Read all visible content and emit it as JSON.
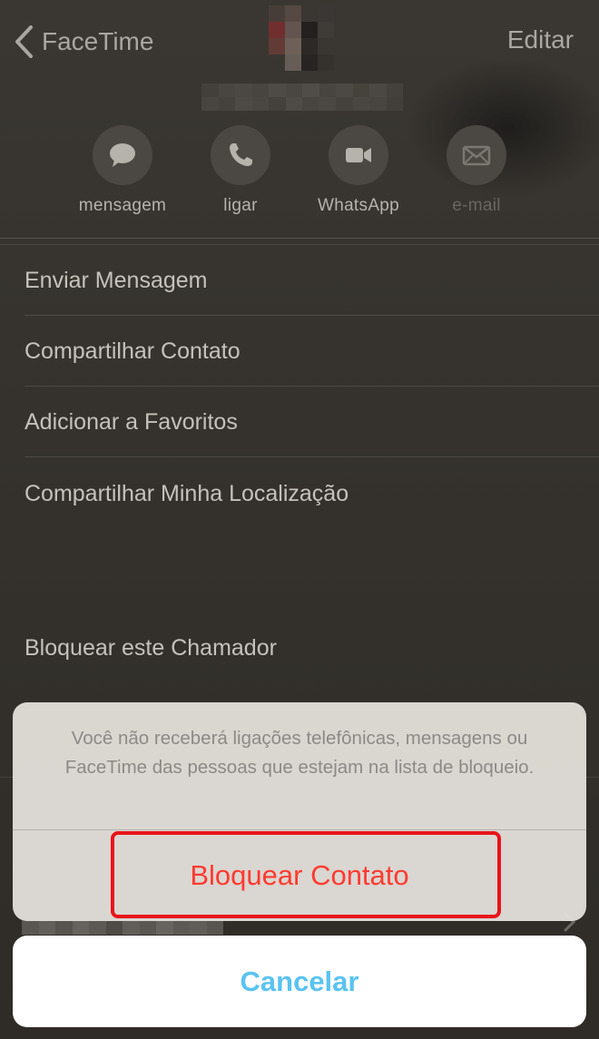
{
  "nav": {
    "back_label": "FaceTime",
    "edit_label": "Editar"
  },
  "actions": [
    {
      "label": "mensagem",
      "icon": "message-bubble-icon",
      "enabled": true
    },
    {
      "label": "ligar",
      "icon": "phone-icon",
      "enabled": true
    },
    {
      "label": "WhatsApp",
      "icon": "video-camera-icon",
      "enabled": true
    },
    {
      "label": "e-mail",
      "icon": "mail-icon",
      "enabled": false
    }
  ],
  "menu": {
    "items": [
      {
        "label": "Enviar Mensagem"
      },
      {
        "label": "Compartilhar Contato"
      },
      {
        "label": "Adicionar a Favoritos"
      },
      {
        "label": "Compartilhar Minha Localização"
      }
    ],
    "block_label": "Bloquear este Chamador"
  },
  "sheet": {
    "message": "Você não receberá ligações telefônicas, mensagens ou FaceTime das pessoas que estejam na lista de bloqueio.",
    "action_label": "Bloquear Contato",
    "cancel_label": "Cancelar"
  },
  "colors": {
    "destructive": "#ff3b30",
    "cancel": "#5ac3f0",
    "highlight": "#e8141b"
  }
}
